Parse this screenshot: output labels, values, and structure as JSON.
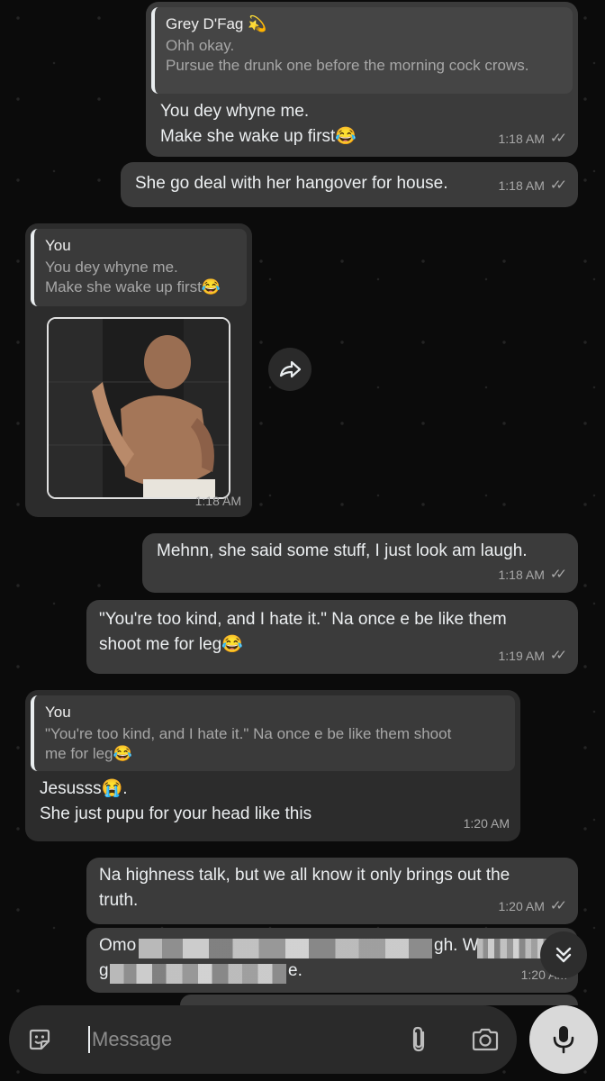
{
  "messages": [
    {
      "quote_name": "Grey D'Fag 💫",
      "quote_text": "Ohh okay.\nPursue the drunk one before the morning cock crows.",
      "text": "You dey whyne me.\nMake she wake up first😂",
      "time": "1:18 AM"
    },
    {
      "text": "She go deal with her hangover for house.",
      "time": "1:18 AM"
    },
    {
      "quote_name": "You",
      "quote_text": "You dey whyne me.\nMake she wake up first😂",
      "time": "1:18 AM"
    },
    {
      "text": "Mehnn, she said some stuff, I just look am laugh.",
      "time": "1:18 AM"
    },
    {
      "text": "\"You're too kind, and I hate it.\" Na once e be like them\nshoot me for leg😂",
      "time": "1:19 AM"
    },
    {
      "quote_name": "You",
      "quote_text": "\"You're too kind, and I hate it.\" Na once e be like them shoot\nme for leg😂",
      "text": "Jesusss😭.\nShe just pupu for your head like this",
      "time": "1:20 AM"
    },
    {
      "text": "Na highness talk, but we all know it only brings out the\ntruth.",
      "time": "1:20 AM"
    },
    {
      "text_start": "Omo",
      "text_mid": "gh. W",
      "text_line2_start": "g",
      "text_line2_end": "e.",
      "time": "1:20 AM"
    }
  ],
  "composer": {
    "placeholder": "Message"
  },
  "icons": {
    "ticks": "✓✓",
    "forward": "forward-icon",
    "emoji": "sticker-icon",
    "attach": "paperclip-icon",
    "camera": "camera-icon",
    "mic": "mic-icon",
    "scroll": "double-chevron-down-icon"
  }
}
